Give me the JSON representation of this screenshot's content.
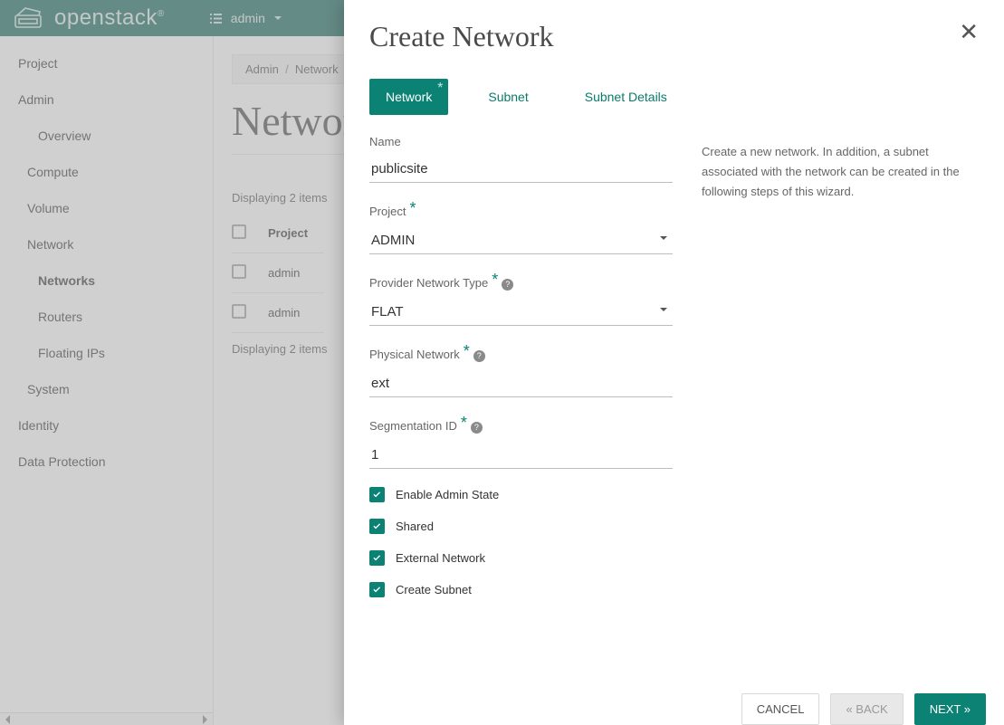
{
  "topbar": {
    "brand": "openstack",
    "project_selector": "admin"
  },
  "sidebar": {
    "items": [
      {
        "label": "Project",
        "type": "head"
      },
      {
        "label": "Admin",
        "type": "head"
      },
      {
        "label": "Overview",
        "type": "sub"
      },
      {
        "label": "Compute",
        "type": "item"
      },
      {
        "label": "Volume",
        "type": "item"
      },
      {
        "label": "Network",
        "type": "item"
      },
      {
        "label": "Networks",
        "type": "sub2",
        "active": true
      },
      {
        "label": "Routers",
        "type": "sub2"
      },
      {
        "label": "Floating IPs",
        "type": "sub2"
      },
      {
        "label": "System",
        "type": "item"
      },
      {
        "label": "Identity",
        "type": "head"
      },
      {
        "label": "Data Protection",
        "type": "head"
      }
    ]
  },
  "breadcrumb": {
    "a": "Admin",
    "b": "Network"
  },
  "page": {
    "title": "Networks",
    "count_top": "Displaying 2 items",
    "count_bottom": "Displaying 2 items",
    "col_project": "Project",
    "rows": [
      {
        "project": "admin"
      },
      {
        "project": "admin"
      }
    ]
  },
  "modal": {
    "title": "Create Network",
    "tabs": {
      "network": "Network",
      "subnet": "Subnet",
      "details": "Subnet Details"
    },
    "description": "Create a new network. In addition, a subnet associated with the network can be created in the following steps of this wizard.",
    "fields": {
      "name": {
        "label": "Name",
        "value": "publicsite"
      },
      "project": {
        "label": "Project",
        "value": "ADMIN"
      },
      "provider_type": {
        "label": "Provider Network Type",
        "value": "FLAT"
      },
      "physical_net": {
        "label": "Physical Network",
        "value": "ext"
      },
      "seg_id": {
        "label": "Segmentation ID",
        "value": "1"
      },
      "enable_admin": {
        "label": "Enable Admin State"
      },
      "shared": {
        "label": "Shared"
      },
      "external": {
        "label": "External Network"
      },
      "create_subnet": {
        "label": "Create Subnet"
      }
    },
    "buttons": {
      "cancel": "CANCEL",
      "back": "«  BACK",
      "next": "NEXT  »"
    }
  }
}
